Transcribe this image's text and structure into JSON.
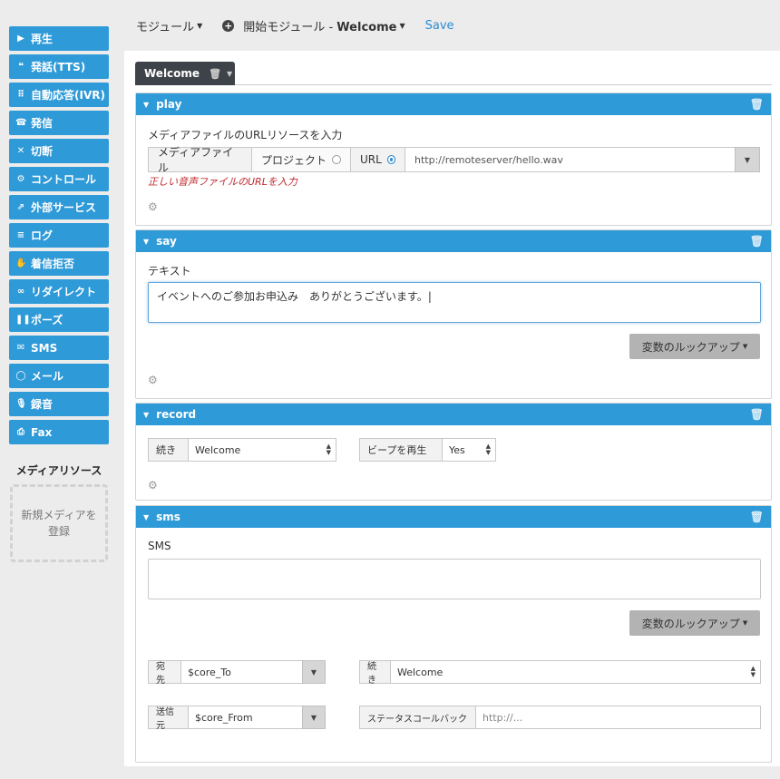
{
  "sidebar": {
    "items": [
      {
        "label": "再生",
        "icon": "play-circle-icon",
        "glyph": "▶"
      },
      {
        "label": "発話(TTS)",
        "icon": "quote-icon",
        "glyph": "❝"
      },
      {
        "label": "自動応答(IVR)",
        "icon": "keypad-icon",
        "glyph": "⠿"
      },
      {
        "label": "発信",
        "icon": "phone-icon",
        "glyph": "☎"
      },
      {
        "label": "切断",
        "icon": "close-icon",
        "glyph": "✕"
      },
      {
        "label": "コントロール",
        "icon": "cogs-icon",
        "glyph": "⚙"
      },
      {
        "label": "外部サービス",
        "icon": "external-link-icon",
        "glyph": "⇗"
      },
      {
        "label": "ログ",
        "icon": "list-icon",
        "glyph": "≡"
      },
      {
        "label": "着信拒否",
        "icon": "thumbs-down-icon",
        "glyph": "✋"
      },
      {
        "label": "リダイレクト",
        "icon": "link-icon",
        "glyph": "∞"
      },
      {
        "label": "ポーズ",
        "icon": "pause-icon",
        "glyph": "❚❚"
      },
      {
        "label": "SMS",
        "icon": "envelope-icon",
        "glyph": "✉"
      },
      {
        "label": "メール",
        "icon": "comment-icon",
        "glyph": "◯"
      },
      {
        "label": "録音",
        "icon": "microphone-icon",
        "glyph": "🎙"
      },
      {
        "label": "Fax",
        "icon": "printer-icon",
        "glyph": "⎙"
      }
    ],
    "media_title": "メディアリソース",
    "media_drop_text": "新規メディアを登録"
  },
  "topbar": {
    "module_menu": "モジュール",
    "start_module_prefix": "開始モジュール - ",
    "start_module_name": "Welcome",
    "save_label": "Save"
  },
  "tab": {
    "label": "Welcome"
  },
  "modules": {
    "play": {
      "title": "play",
      "field_label": "メディアファイルのURLリソースを入力",
      "seg_media": "メディアファイル",
      "seg_project": "プロジェクト",
      "seg_url": "URL",
      "url_value": "http://remoteserver/hello.wav",
      "error": "正しい音声ファイルのURLを入力"
    },
    "say": {
      "title": "say",
      "field_label": "テキスト",
      "text_value": "イベントへのご参加お申込み　ありがとうございます。",
      "lookup_label": "変数のルックアップ"
    },
    "record": {
      "title": "record",
      "next_label": "続き",
      "next_value": "Welcome",
      "beep_label": "ビープを再生",
      "beep_value": "Yes"
    },
    "sms": {
      "title": "sms",
      "field_label": "SMS",
      "text_value": "",
      "lookup_label": "変数のルックアップ",
      "to_label": "宛先",
      "to_value": "$core_To",
      "next_label": "続き",
      "next_value": "Welcome",
      "from_label": "送信元",
      "from_value": "$core_From",
      "callback_label": "ステータスコールバック",
      "callback_placeholder": "http://..."
    }
  },
  "colors": {
    "accent": "#2e9ad8",
    "tab_dark": "#3e4349",
    "error": "#c0282d",
    "link": "#2e8bd1"
  }
}
